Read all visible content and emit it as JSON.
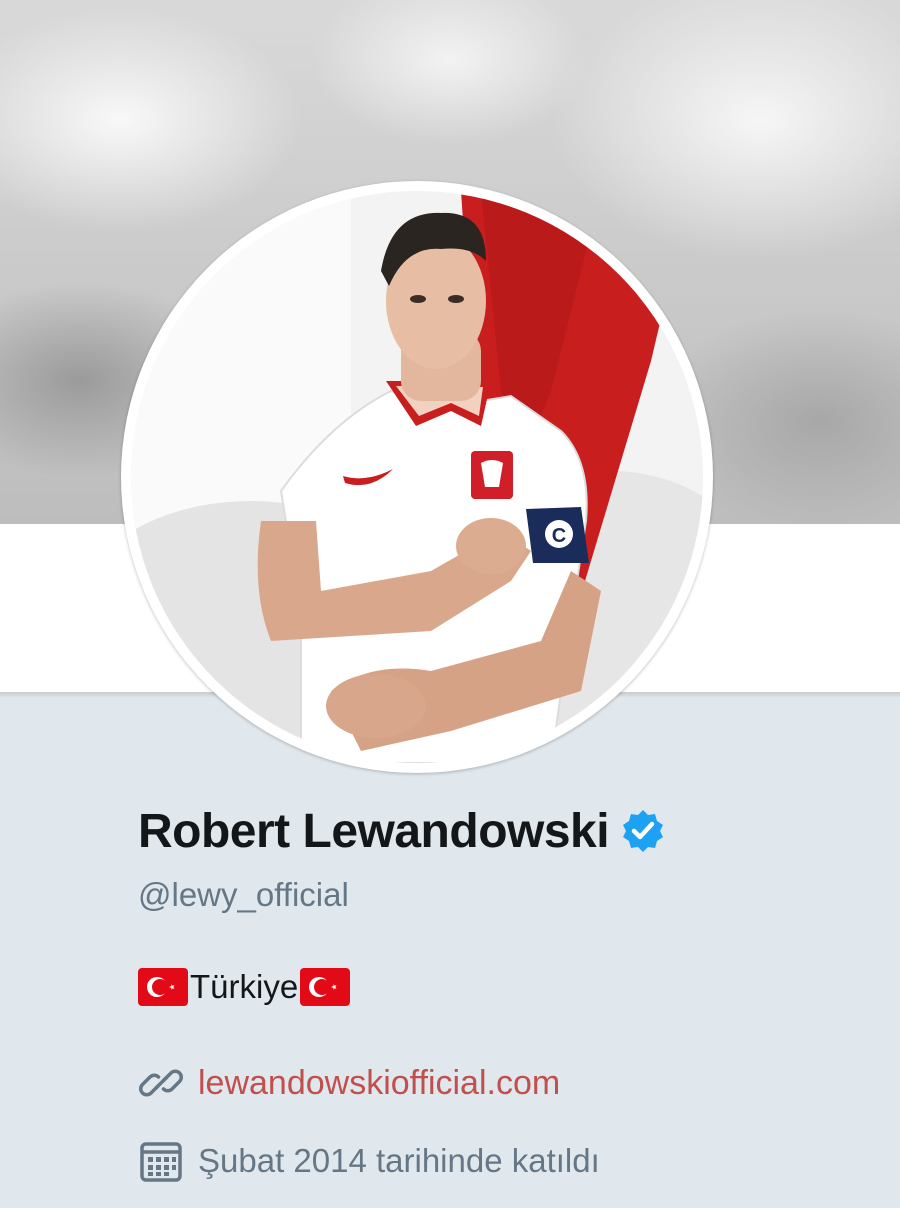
{
  "profile": {
    "name": "Robert Lewandowski",
    "handle": "@lewy_official",
    "location": "Türkiye",
    "website": "lewandowskiofficial.com",
    "joined": "Şubat 2014 tarihinde katıldı",
    "verified": true
  },
  "icons": {
    "verified": "verified-badge-icon",
    "flag": "turkey-flag-icon",
    "link": "link-icon",
    "calendar": "calendar-icon"
  },
  "colors": {
    "name": "#14171a",
    "secondary_text": "#657786",
    "link": "#c0504d",
    "verified": "#1da1f2",
    "background": "#e1e8ed",
    "flag_red": "#e30a17"
  }
}
